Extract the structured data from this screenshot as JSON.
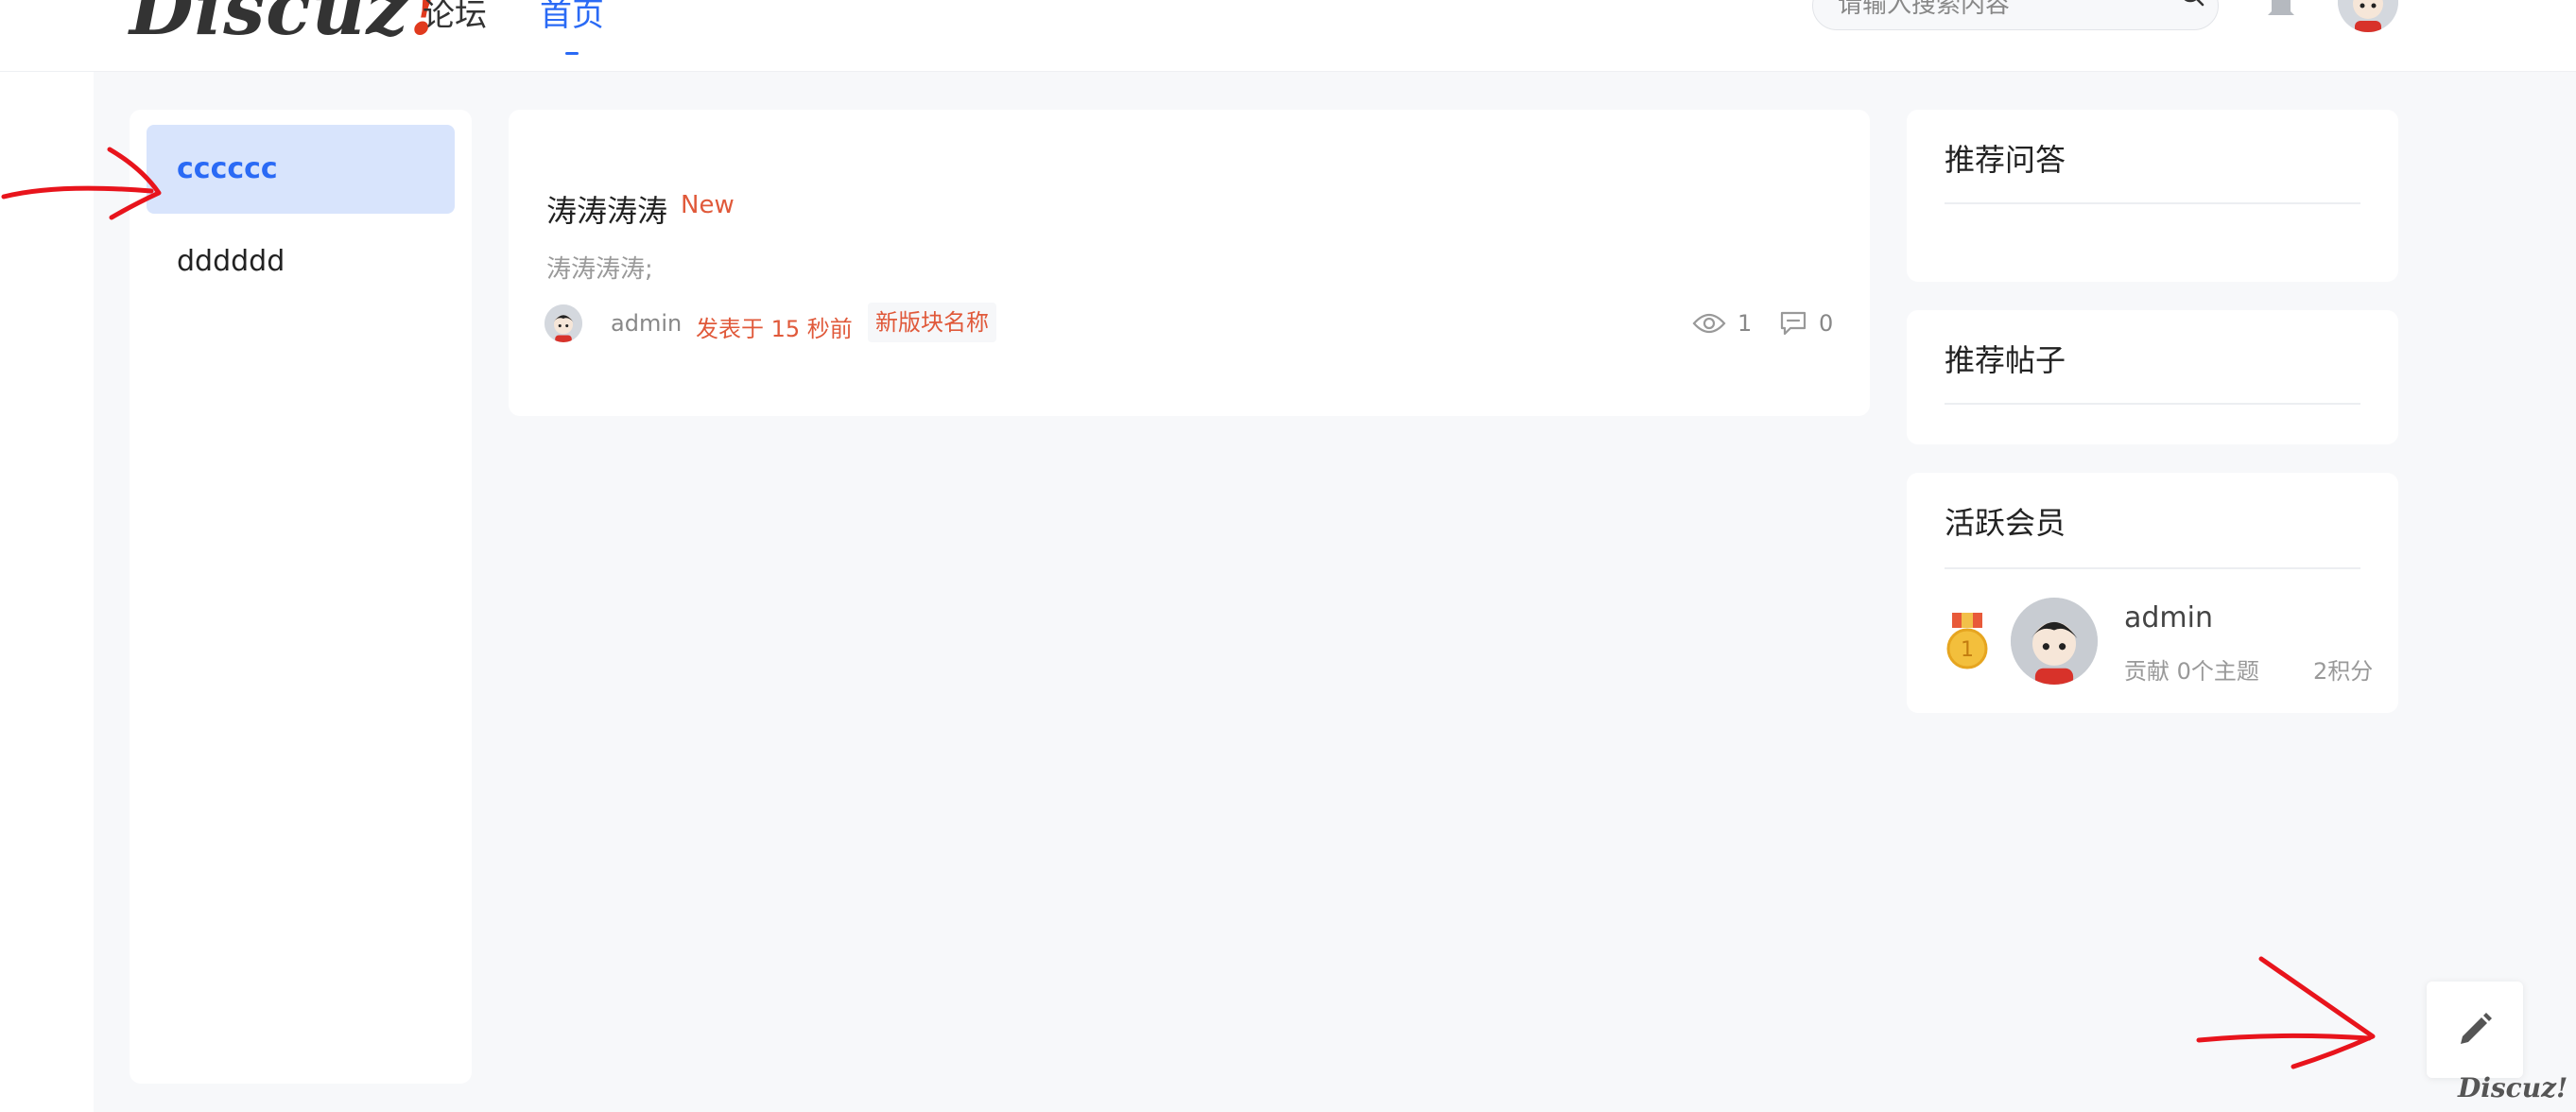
{
  "header": {
    "logo_text": "Discuz",
    "logo_bang": "!",
    "nav": [
      {
        "label": "论坛"
      },
      {
        "label": "首页"
      }
    ],
    "search_placeholder": "请输入搜索内容"
  },
  "sidebar": {
    "items": [
      {
        "label": "cccccc",
        "active": true
      },
      {
        "label": "dddddd",
        "active": false
      }
    ]
  },
  "post": {
    "title": "涛涛涛涛",
    "badge": "New",
    "excerpt": "涛涛涛涛;",
    "author": "admin",
    "time": "发表于 15 秒前",
    "board": "新版块名称",
    "views": "1",
    "comments": "0"
  },
  "widgets": {
    "recommended_qa": {
      "title": "推荐问答"
    },
    "recommended_posts": {
      "title": "推荐帖子"
    },
    "active_members": {
      "title": "活跃会员",
      "members": [
        {
          "name": "admin",
          "contribution": "贡献 0个主题",
          "points": "2积分",
          "rank": "1"
        }
      ]
    }
  },
  "watermark": "Discuz!",
  "colors": {
    "accent": "#2a6af5",
    "highlight": "#e0593a",
    "active_bg": "#d8e4fc",
    "annotation": "#e8141c"
  }
}
